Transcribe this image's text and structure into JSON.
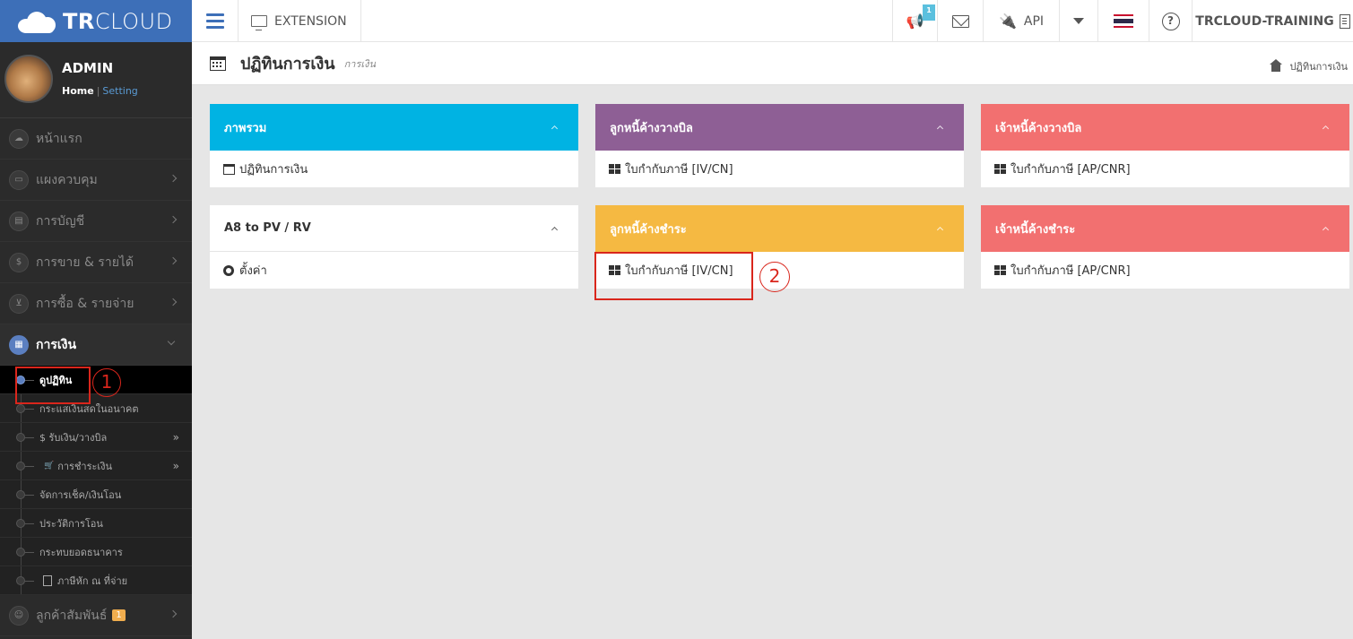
{
  "topbar": {
    "logo_bold": "TR",
    "logo_light": "CLOUD",
    "extension_label": "EXTENSION",
    "notification_count": "1",
    "api_label": "API",
    "company_name": "TRCLOUD-TRAINING",
    "help_glyph": "?"
  },
  "sidebar": {
    "profile": {
      "name": "ADMIN",
      "home_link": "Home",
      "separator": "|",
      "setting_link": "Setting"
    },
    "menu": [
      {
        "label": "หน้าแรก",
        "icon": "cloud-icon"
      },
      {
        "label": "แผงควบคุม",
        "icon": "monitor-icon"
      },
      {
        "label": "การบัญชี",
        "icon": "book-icon"
      },
      {
        "label": "การขาย & รายได้",
        "icon": "dollar-icon"
      },
      {
        "label": "การซื้อ & รายจ่าย",
        "icon": "cart-icon"
      },
      {
        "label": "การเงิน",
        "icon": "calendar-icon"
      }
    ],
    "submenu": [
      {
        "label": "ดูปฏิทิน"
      },
      {
        "label": "กระแสเงินสดในอนาคต"
      },
      {
        "label": "$ รับเงิน/วางบิล"
      },
      {
        "label": "การชำระเงิน"
      },
      {
        "label": "จัดการเช็ค/เงินโอน"
      },
      {
        "label": "ประวัติการโอน"
      },
      {
        "label": "กระทบยอดธนาคาร"
      },
      {
        "label": "ภาษีหัก ณ ที่จ่าย"
      }
    ],
    "crm": {
      "label": "ลูกค้าสัมพันธ์",
      "badge": "1"
    }
  },
  "header": {
    "title": "ปฏิทินการเงิน",
    "subtitle": "การเงิน",
    "breadcrumb": "ปฏิทินการเงิน"
  },
  "panels": [
    {
      "title": "ภาพรวม",
      "color": "#00b3e3",
      "item": "ปฏิทินการเงิน"
    },
    {
      "title": "ลูกหนี้ค้างวางบิล",
      "color": "#8e5f95",
      "item": "ใบกำกับภาษี [IV/CN]"
    },
    {
      "title": "เจ้าหนี้ค้างวางบิล",
      "color": "#f27070",
      "item": "ใบกำกับภาษี [AP/CNR]"
    },
    {
      "title": "A8 to PV / RV",
      "color": "#ffffff",
      "item": "ตั้งค่า"
    },
    {
      "title": "ลูกหนี้ค้างชำระ",
      "color": "#f5b942",
      "item": "ใบกำกับภาษี [IV/CN]"
    },
    {
      "title": "เจ้าหนี้ค้างชำระ",
      "color": "#f27070",
      "item": "ใบกำกับภาษี [AP/CNR]"
    }
  ],
  "callouts": [
    "1",
    "2"
  ]
}
